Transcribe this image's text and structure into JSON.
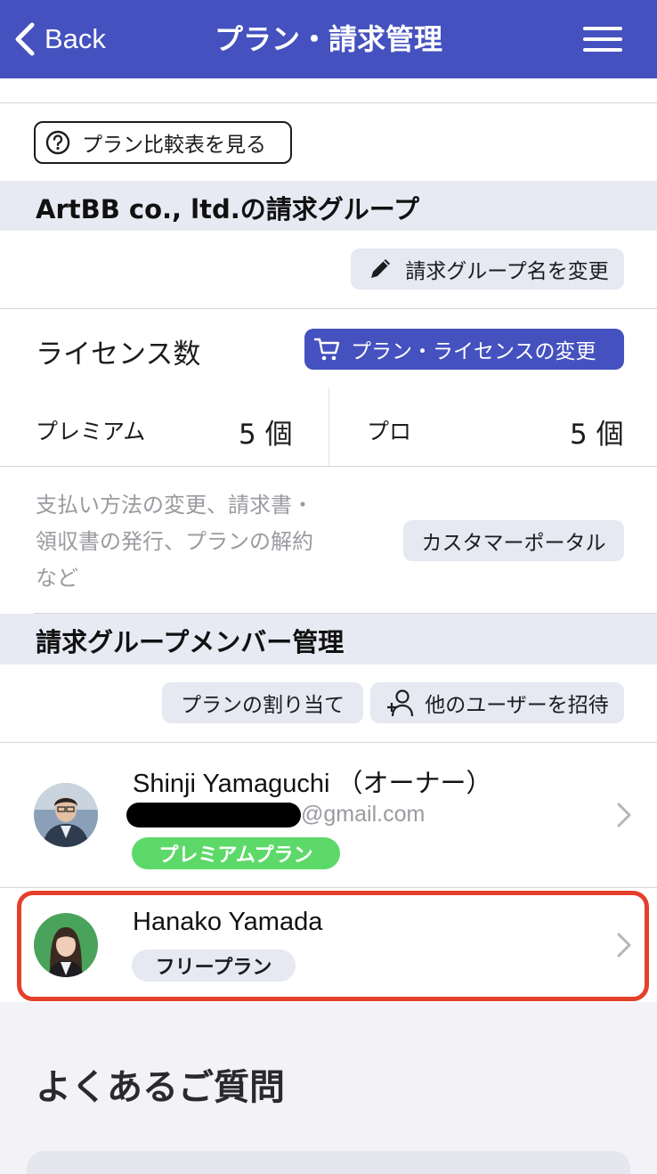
{
  "header": {
    "back_label": "Back",
    "title": "プラン・請求管理"
  },
  "compare_button": {
    "label": "プラン比較表を見る",
    "icon": "question-circle-icon"
  },
  "billing_group": {
    "title": "ArtBB co., ltd.の請求グループ",
    "rename_button": "請求グループ名を変更",
    "license_label": "ライセンス数",
    "change_license_button": "プラン・ライセンスの変更",
    "plans": [
      {
        "name": "プレミアム",
        "count": "5 個"
      },
      {
        "name": "プロ",
        "count": "5 個"
      }
    ],
    "portal_description_lines": [
      "支払い方法の変更、請求書・",
      "領収書の発行、プランの解約",
      "など"
    ],
    "portal_button": "カスタマーポータル"
  },
  "members": {
    "title": "請求グループメンバー管理",
    "assign_button": "プランの割り当て",
    "invite_button": "他のユーザーを招待",
    "list": [
      {
        "name": "Shinji Yamaguchi （オーナー）",
        "email_suffix": "@gmail.com",
        "plan": "プレミアムプラン"
      },
      {
        "name": "Hanako Yamada",
        "plan": "フリープラン"
      }
    ]
  },
  "faq": {
    "title": "よくあるご質問"
  },
  "colors": {
    "header": "#4451be",
    "section_band": "#e8eaf3",
    "pill": "#e6e8f2",
    "premium_badge": "#5dd96a",
    "highlight": "#e4402c"
  }
}
